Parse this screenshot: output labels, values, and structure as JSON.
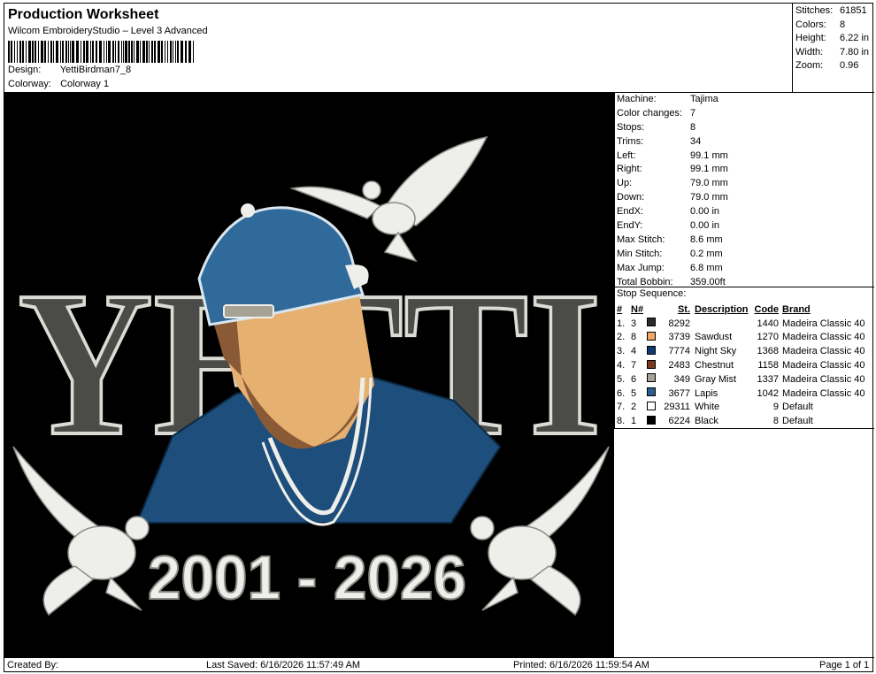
{
  "header": {
    "title": "Production Worksheet",
    "software": "Wilcom EmbroideryStudio – Level 3 Advanced",
    "design_label": "Design:",
    "design_value": "YettiBirdman7_8",
    "colorway_label": "Colorway:",
    "colorway_value": "Colorway 1"
  },
  "summary": [
    {
      "label": "Stitches:",
      "value": "61851"
    },
    {
      "label": "Colors:",
      "value": "8"
    },
    {
      "label": "Height:",
      "value": "6.22 in"
    },
    {
      "label": "Width:",
      "value": "7.80 in"
    },
    {
      "label": "Zoom:",
      "value": "0.96"
    }
  ],
  "machine_info": [
    {
      "label": "Machine:",
      "value": "Tajima"
    },
    {
      "label": "Color changes:",
      "value": "7"
    },
    {
      "label": "Stops:",
      "value": "8"
    },
    {
      "label": "Trims:",
      "value": "34"
    },
    {
      "label": "Left:",
      "value": "99.1 mm"
    },
    {
      "label": "Right:",
      "value": "99.1 mm"
    },
    {
      "label": "Up:",
      "value": "79.0 mm"
    },
    {
      "label": "Down:",
      "value": "79.0 mm"
    },
    {
      "label": "EndX:",
      "value": "0.00 in"
    },
    {
      "label": "EndY:",
      "value": "0.00 in"
    },
    {
      "label": "Max Stitch:",
      "value": "8.6 mm"
    },
    {
      "label": "Min Stitch:",
      "value": "0.2 mm"
    },
    {
      "label": "Max Jump:",
      "value": "6.8 mm"
    },
    {
      "label": "Total Bobbin:",
      "value": "359.00ft"
    }
  ],
  "stop_sequence": {
    "title": "Stop Sequence:",
    "columns": {
      "num": "#",
      "needle": "N#",
      "st": "St.",
      "desc": "Description",
      "code": "Code",
      "brand": "Brand"
    },
    "rows": [
      {
        "num": "1.",
        "needle": "3",
        "color": "#2b2b2b",
        "st": "8292",
        "desc": "",
        "code": "1440",
        "brand": "Madeira Classic 40"
      },
      {
        "num": "2.",
        "needle": "8",
        "color": "#f0a867",
        "st": "3739",
        "desc": "Sawdust",
        "code": "1270",
        "brand": "Madeira Classic 40"
      },
      {
        "num": "3.",
        "needle": "4",
        "color": "#0f3a73",
        "st": "7774",
        "desc": "Night Sky",
        "code": "1368",
        "brand": "Madeira Classic 40"
      },
      {
        "num": "4.",
        "needle": "7",
        "color": "#7a3a22",
        "st": "2483",
        "desc": "Chestnut",
        "code": "1158",
        "brand": "Madeira Classic 40"
      },
      {
        "num": "5.",
        "needle": "6",
        "color": "#a6a396",
        "st": "349",
        "desc": "Gray Mist",
        "code": "1337",
        "brand": "Madeira Classic 40"
      },
      {
        "num": "6.",
        "needle": "5",
        "color": "#2c5d8c",
        "st": "3677",
        "desc": "Lapis",
        "code": "1042",
        "brand": "Madeira Classic 40"
      },
      {
        "num": "7.",
        "needle": "2",
        "color": "#ffffff",
        "st": "29311",
        "desc": "White",
        "code": "9",
        "brand": "Default"
      },
      {
        "num": "8.",
        "needle": "1",
        "color": "#000000",
        "st": "6224",
        "desc": "Black",
        "code": "8",
        "brand": "Default"
      }
    ]
  },
  "design": {
    "arch_text": "YETTI",
    "year_text": "2001 - 2026",
    "colors": {
      "background": "#000000",
      "arch": "#4b4b48",
      "cap": "#2f6a9a",
      "skin": "#e6b070",
      "beard": "#8a5a36",
      "shirt": "#1d4e7c",
      "white": "#eeeeea"
    }
  },
  "footer": {
    "created_by": "Created By:",
    "last_saved": "Last Saved: 6/16/2026 11:57:49 AM",
    "printed": "Printed: 6/16/2026 11:59:54 AM",
    "page": "Page 1 of 1"
  }
}
